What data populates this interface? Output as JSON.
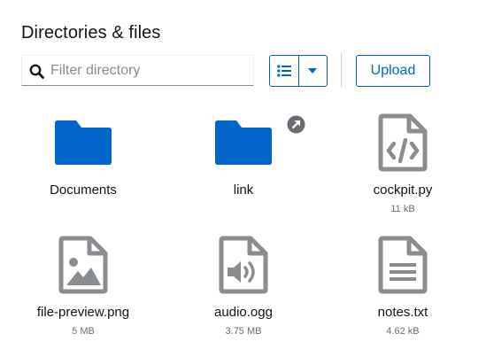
{
  "title": "Directories & files",
  "filter": {
    "placeholder": "Filter directory",
    "value": ""
  },
  "toolbar": {
    "upload_label": "Upload"
  },
  "colors": {
    "accent": "#0066cc",
    "file_icon": "#8a8d90",
    "link_badge": "#6a6e73"
  },
  "items": [
    {
      "name": "Documents",
      "type": "folder",
      "icon": "folder-icon",
      "size": ""
    },
    {
      "name": "link",
      "type": "folder-link",
      "icon": "folder-icon",
      "size": ""
    },
    {
      "name": "cockpit.py",
      "type": "code",
      "icon": "file-code-icon",
      "size": "11 kB"
    },
    {
      "name": "file-preview.png",
      "type": "image",
      "icon": "file-image-icon",
      "size": "5 MB"
    },
    {
      "name": "audio.ogg",
      "type": "audio",
      "icon": "file-audio-icon",
      "size": "3.75 MB"
    },
    {
      "name": "notes.txt",
      "type": "text",
      "icon": "file-text-icon",
      "size": "4.62 kB"
    }
  ]
}
